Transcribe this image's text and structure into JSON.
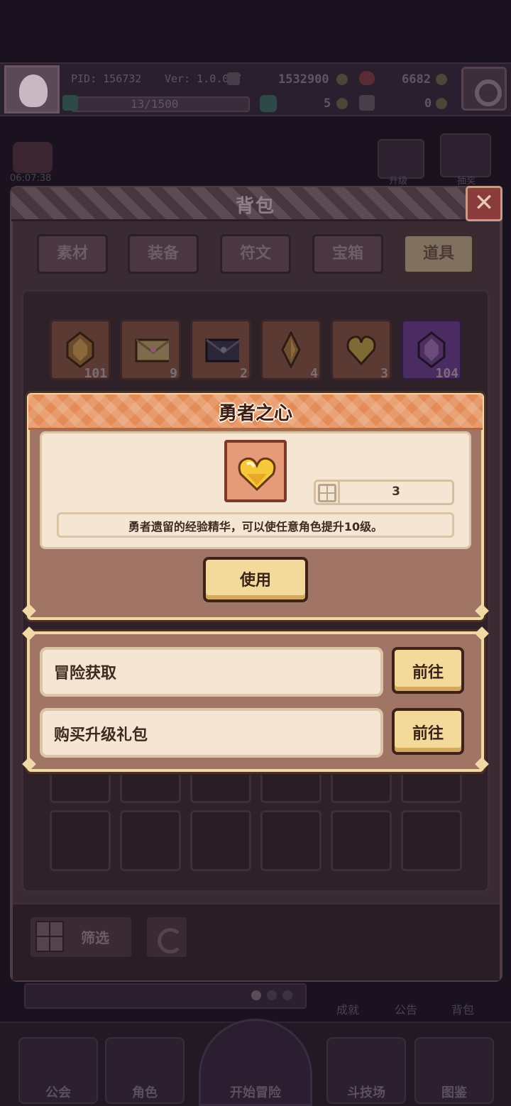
{
  "hud": {
    "pid": "PID: 156732",
    "version": "Ver: 1.0.0.7",
    "gold": "1532900",
    "hearts": "6682",
    "exp": "13/1500",
    "clover": "5",
    "keys": "0",
    "timer": "06:07:38",
    "right_icon_1": "升级",
    "right_icon_2": "抽奖"
  },
  "bag": {
    "title": "背包",
    "close_symbol": "✕",
    "tabs": [
      {
        "label": "素材"
      },
      {
        "label": "装备"
      },
      {
        "label": "符文"
      },
      {
        "label": "宝箱"
      },
      {
        "label": "道具",
        "active": true
      }
    ],
    "items": [
      {
        "icon": "amber-gem-icon",
        "count": "101"
      },
      {
        "icon": "letter-envelope-icon",
        "count": "9"
      },
      {
        "icon": "dark-envelope-icon",
        "count": "2"
      },
      {
        "icon": "crystal-shard-icon",
        "count": "4"
      },
      {
        "icon": "gold-heart-icon",
        "count": "3"
      },
      {
        "icon": "purple-gem-icon",
        "count": "104"
      }
    ],
    "filter_label": "筛选"
  },
  "detail": {
    "title": "勇者之心",
    "count": "3",
    "description": "勇者遗留的经验精华，可以使任意角色提升10级。",
    "use_label": "使用",
    "heart_color": "#f6c93a"
  },
  "sources": [
    {
      "label": "冒险获取",
      "button": "前往"
    },
    {
      "label": "购买升级礼包",
      "button": "前往"
    }
  ],
  "background_menu": {
    "achievement": "成就",
    "notice": "公告",
    "backpack": "背包"
  },
  "nav": [
    {
      "label": "公会"
    },
    {
      "label": "角色"
    },
    {
      "label": "开始冒险"
    },
    {
      "label": "斗技场"
    },
    {
      "label": "图鉴"
    }
  ]
}
